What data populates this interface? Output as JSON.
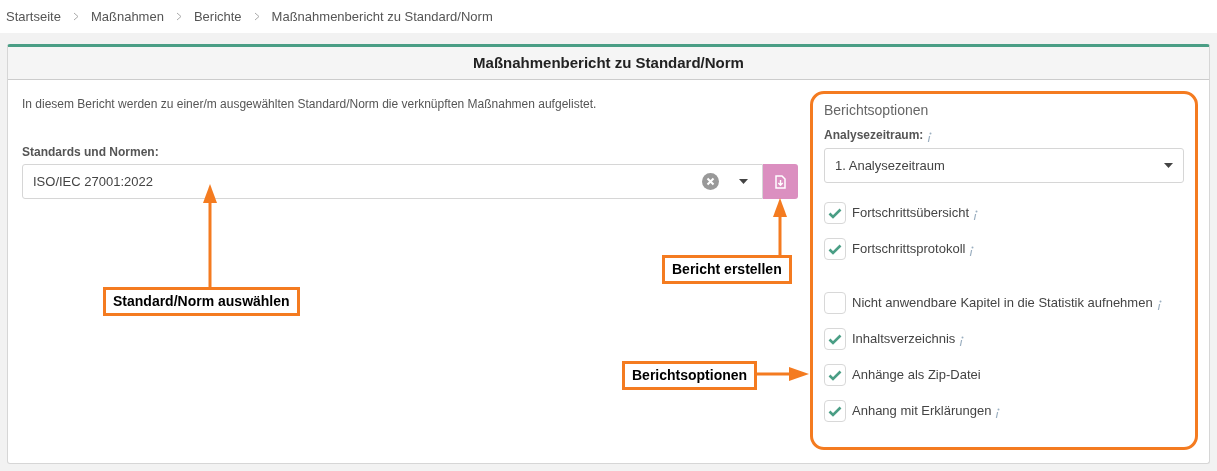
{
  "breadcrumb": [
    "Startseite",
    "Maßnahmen",
    "Berichte",
    "Maßnahmenbericht zu Standard/Norm"
  ],
  "card": {
    "title": "Maßnahmenbericht zu Standard/Norm",
    "description": "In diesem Bericht werden zu einer/m ausgewählten Standard/Norm die verknüpften Maßnahmen aufgelistet.",
    "field_label": "Standards und Normen:",
    "field_value": "ISO/IEC 27001:2022"
  },
  "options": {
    "title": "Berichtsoptionen",
    "period_label": "Analysezeitraum:",
    "period_value": "1. Analysezeitraum",
    "groups": [
      [
        {
          "label": "Fortschrittsübersicht",
          "checked": true,
          "info": true
        },
        {
          "label": "Fortschrittsprotokoll",
          "checked": true,
          "info": true
        }
      ],
      [
        {
          "label": "Nicht anwendbare Kapitel in die Statistik aufnehmen",
          "checked": false,
          "info": true
        },
        {
          "label": "Inhaltsverzeichnis",
          "checked": true,
          "info": true
        },
        {
          "label": "Anhänge als Zip-Datei",
          "checked": true,
          "info": false
        },
        {
          "label": "Anhang mit Erklärungen",
          "checked": true,
          "info": true
        }
      ]
    ]
  },
  "callouts": [
    {
      "kind": "up",
      "text": "Standard/Norm auswählen"
    },
    {
      "kind": "up-right",
      "text": "Bericht erstellen"
    },
    {
      "kind": "right",
      "text": "Berichtsoptionen"
    }
  ]
}
